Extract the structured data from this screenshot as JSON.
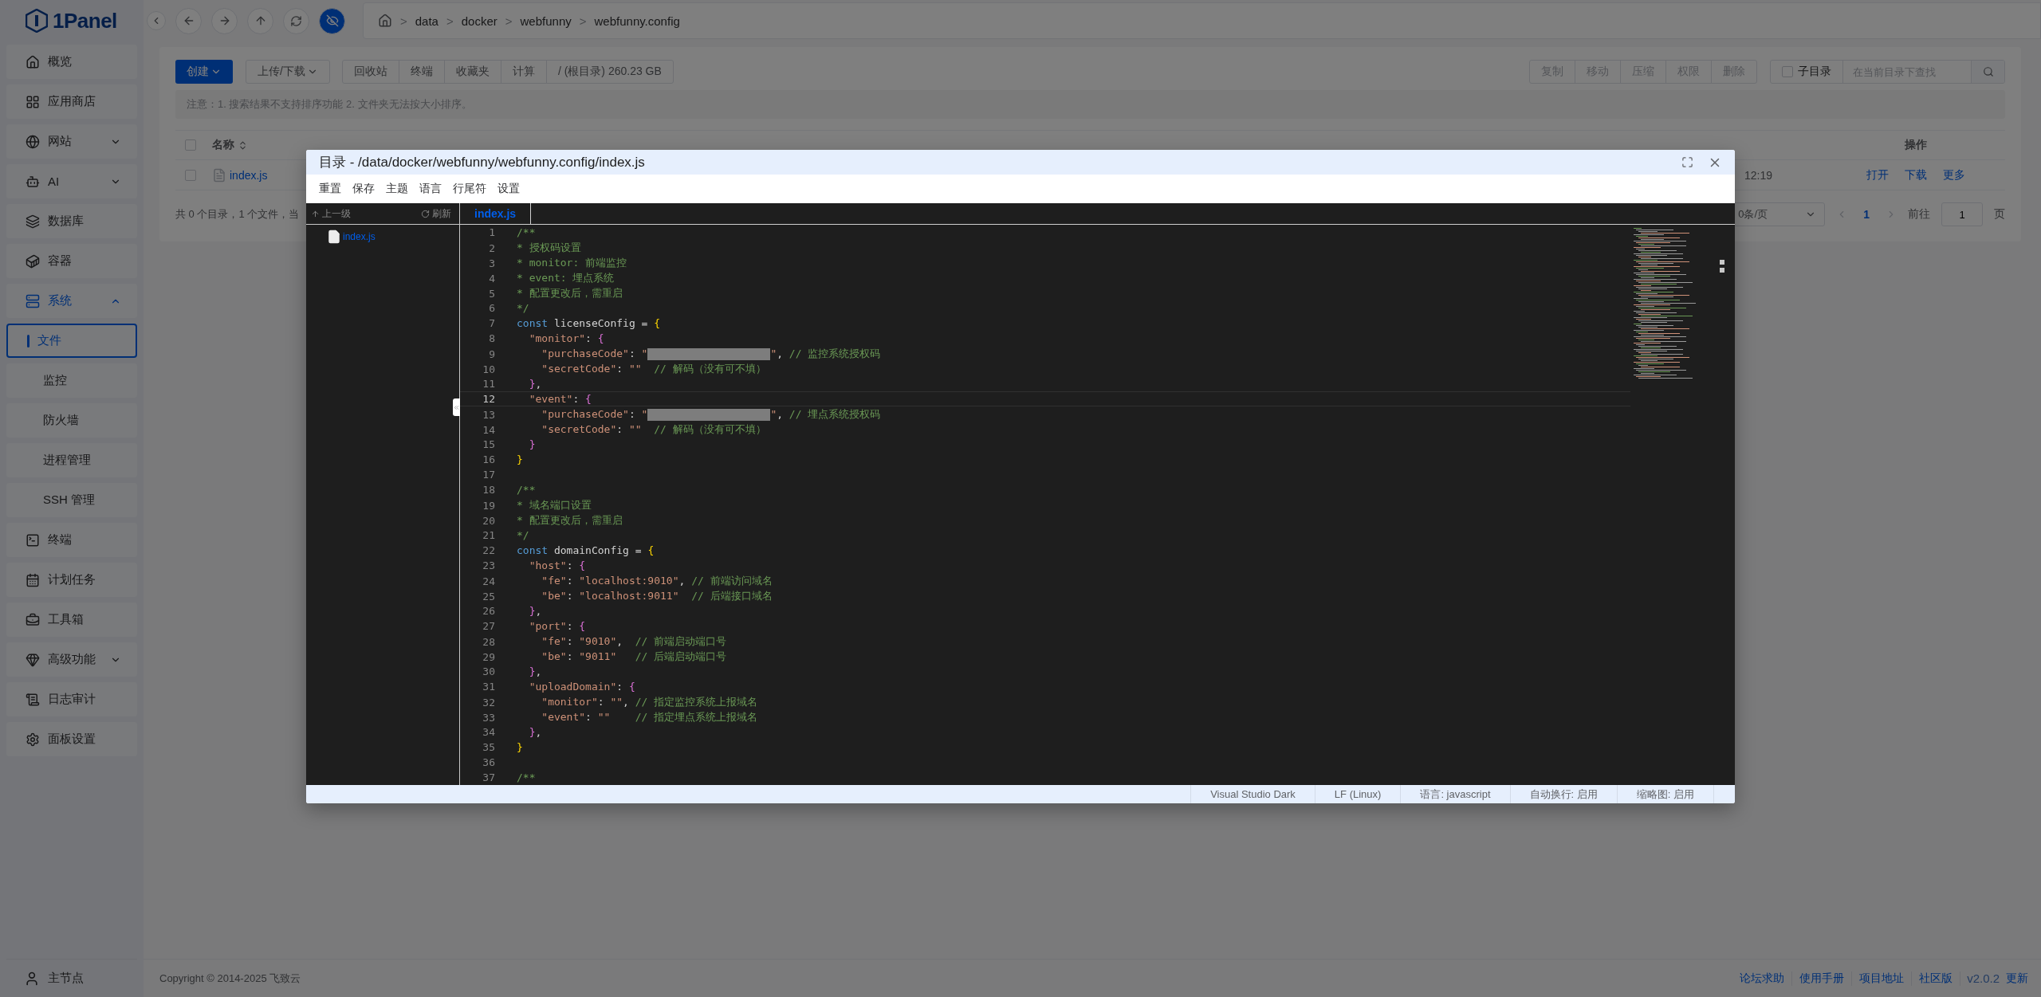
{
  "logo": {
    "text": "1Panel"
  },
  "breadcrumb": [
    {
      "separator": ">",
      "label": "data"
    },
    {
      "separator": ">",
      "label": "docker"
    },
    {
      "separator": ">",
      "label": "webfunny"
    },
    {
      "separator": ">",
      "label": "webfunny.config"
    }
  ],
  "sidebar": {
    "items": [
      {
        "label": "概览",
        "selected": false
      },
      {
        "label": "应用商店",
        "selected": false
      },
      {
        "label": "网站",
        "selected": false,
        "expanded": false
      },
      {
        "label": "AI",
        "selected": false,
        "expanded": false
      },
      {
        "label": "数据库",
        "selected": false
      },
      {
        "label": "容器",
        "selected": false
      },
      {
        "label": "系统",
        "selected": true,
        "expanded": true,
        "children": [
          {
            "label": "文件",
            "selected": true
          },
          {
            "label": "监控",
            "selected": false
          },
          {
            "label": "防火墙",
            "selected": false
          },
          {
            "label": "进程管理",
            "selected": false
          },
          {
            "label": "SSH 管理",
            "selected": false
          }
        ]
      },
      {
        "label": "终端",
        "selected": false
      },
      {
        "label": "计划任务",
        "selected": false
      },
      {
        "label": "工具箱",
        "selected": false
      },
      {
        "label": "高级功能",
        "selected": false,
        "expanded": false
      },
      {
        "label": "日志审计",
        "selected": false
      },
      {
        "label": "面板设置",
        "selected": false
      }
    ],
    "node": "主节点"
  },
  "toolbar": {
    "create": "创建",
    "upload": "上传/下载",
    "group": [
      "回收站",
      "终端",
      "收藏夹",
      "计算"
    ],
    "disk": "/ (根目录) 260.23 GB",
    "actions": [
      "复制",
      "移动",
      "压缩",
      "权限",
      "删除"
    ],
    "subdir": {
      "label": "子目录",
      "checked": false
    },
    "search": {
      "placeholder": "在当前目录下查找"
    }
  },
  "notice": "注意：1. 搜索结果不支持排序功能 2. 文件夹无法按大小排序。",
  "table": {
    "header_checked": false,
    "columns": [
      "名称",
      "操作"
    ],
    "rows": [
      {
        "checked": false,
        "name": "index.js",
        "time": "12:19",
        "actions": [
          "打开",
          "下载",
          "更多"
        ]
      }
    ]
  },
  "summary": "共 0 个目录，1 个文件，当",
  "pagination": {
    "page_size": "0条/页",
    "pages": [
      {
        "label": "1",
        "selected": true
      }
    ],
    "goto_label": "前往",
    "goto_value": "1",
    "unit": "页"
  },
  "footer": {
    "copyright": "Copyright © 2014-2025 飞致云",
    "links": [
      "论坛求助",
      "使用手册",
      "项目地址",
      "社区版"
    ],
    "version": "v2.0.2",
    "update": "更新"
  },
  "editor": {
    "title": "目录 - /data/docker/webfunny/webfunny.config/index.js",
    "menu": [
      "重置",
      "保存",
      "主题",
      "语言",
      "行尾符",
      "设置"
    ],
    "tree": {
      "up": "上一级",
      "refresh": "刷新",
      "files": [
        {
          "name": "index.js",
          "selected": true
        }
      ]
    },
    "tabs": [
      {
        "label": "index.js",
        "selected": true
      }
    ],
    "lines": [
      {
        "number": "1",
        "active": false,
        "tokens": [
          {
            "kind": "comment",
            "text": "/**"
          }
        ]
      },
      {
        "number": "2",
        "active": false,
        "tokens": [
          {
            "kind": "comment",
            "text": "* 授权码设置"
          }
        ]
      },
      {
        "number": "3",
        "active": false,
        "tokens": [
          {
            "kind": "comment",
            "text": "* monitor: 前端监控"
          }
        ]
      },
      {
        "number": "4",
        "active": false,
        "tokens": [
          {
            "kind": "comment",
            "text": "* event: 埋点系统"
          }
        ]
      },
      {
        "number": "5",
        "active": false,
        "tokens": [
          {
            "kind": "comment",
            "text": "* 配置更改后，需重启"
          }
        ]
      },
      {
        "number": "6",
        "active": false,
        "tokens": [
          {
            "kind": "comment",
            "text": "*/"
          }
        ]
      },
      {
        "number": "7",
        "active": false,
        "tokens": [
          {
            "kind": "keyword",
            "text": "const"
          },
          {
            "kind": "plain",
            "text": " licenseConfig = "
          },
          {
            "kind": "bracket1",
            "text": "{"
          }
        ]
      },
      {
        "number": "8",
        "active": false,
        "tokens": [
          {
            "kind": "string",
            "text": "  \"monitor\""
          },
          {
            "kind": "plain",
            "text": ": "
          },
          {
            "kind": "bracket2",
            "text": "{"
          }
        ]
      },
      {
        "number": "9",
        "active": false,
        "tokens": [
          {
            "kind": "string",
            "text": "    \"purchaseCode\""
          },
          {
            "kind": "plain",
            "text": ": "
          },
          {
            "kind": "string",
            "text": "\""
          },
          {
            "kind": "redacted"
          },
          {
            "kind": "string",
            "text": "\""
          },
          {
            "kind": "plain",
            "text": ", "
          },
          {
            "kind": "comment",
            "text": "// 监控系统授权码"
          }
        ]
      },
      {
        "number": "10",
        "active": false,
        "tokens": [
          {
            "kind": "string",
            "text": "    \"secretCode\""
          },
          {
            "kind": "plain",
            "text": ": "
          },
          {
            "kind": "string",
            "text": "\"\""
          },
          {
            "kind": "comment",
            "text": "  // 解码（没有可不填）"
          }
        ]
      },
      {
        "number": "11",
        "active": false,
        "tokens": [
          {
            "kind": "bracket2",
            "text": "  }"
          },
          {
            "kind": "plain",
            "text": ","
          }
        ]
      },
      {
        "number": "12",
        "active": true,
        "tokens": [
          {
            "kind": "string",
            "text": "  \"event\""
          },
          {
            "kind": "plain",
            "text": ": "
          },
          {
            "kind": "bracket2",
            "text": "{"
          }
        ]
      },
      {
        "number": "13",
        "active": false,
        "tokens": [
          {
            "kind": "string",
            "text": "    \"purchaseCode\""
          },
          {
            "kind": "plain",
            "text": ": "
          },
          {
            "kind": "string",
            "text": "\""
          },
          {
            "kind": "redacted"
          },
          {
            "kind": "string",
            "text": "\""
          },
          {
            "kind": "plain",
            "text": ", "
          },
          {
            "kind": "comment",
            "text": "// 埋点系统授权码"
          }
        ]
      },
      {
        "number": "14",
        "active": false,
        "tokens": [
          {
            "kind": "string",
            "text": "    \"secretCode\""
          },
          {
            "kind": "plain",
            "text": ": "
          },
          {
            "kind": "string",
            "text": "\"\""
          },
          {
            "kind": "comment",
            "text": "  // 解码（没有可不填）"
          }
        ]
      },
      {
        "number": "15",
        "active": false,
        "tokens": [
          {
            "kind": "bracket2",
            "text": "  }"
          }
        ]
      },
      {
        "number": "16",
        "active": false,
        "tokens": [
          {
            "kind": "bracket1",
            "text": "}"
          }
        ]
      },
      {
        "number": "17",
        "active": false
      },
      {
        "number": "18",
        "active": false,
        "tokens": [
          {
            "kind": "comment",
            "text": "/**"
          }
        ]
      },
      {
        "number": "19",
        "active": false,
        "tokens": [
          {
            "kind": "comment",
            "text": "* 域名端口设置"
          }
        ]
      },
      {
        "number": "20",
        "active": false,
        "tokens": [
          {
            "kind": "comment",
            "text": "* 配置更改后，需重启"
          }
        ]
      },
      {
        "number": "21",
        "active": false,
        "tokens": [
          {
            "kind": "comment",
            "text": "*/"
          }
        ]
      },
      {
        "number": "22",
        "active": false,
        "tokens": [
          {
            "kind": "keyword",
            "text": "const"
          },
          {
            "kind": "plain",
            "text": " domainConfig = "
          },
          {
            "kind": "bracket1",
            "text": "{"
          }
        ]
      },
      {
        "number": "23",
        "active": false,
        "tokens": [
          {
            "kind": "string",
            "text": "  \"host\""
          },
          {
            "kind": "plain",
            "text": ": "
          },
          {
            "kind": "bracket2",
            "text": "{"
          }
        ]
      },
      {
        "number": "24",
        "active": false,
        "tokens": [
          {
            "kind": "string",
            "text": "    \"fe\""
          },
          {
            "kind": "plain",
            "text": ": "
          },
          {
            "kind": "string",
            "text": "\"localhost:9010\""
          },
          {
            "kind": "plain",
            "text": ", "
          },
          {
            "kind": "comment",
            "text": "// 前端访问域名"
          }
        ]
      },
      {
        "number": "25",
        "active": false,
        "tokens": [
          {
            "kind": "string",
            "text": "    \"be\""
          },
          {
            "kind": "plain",
            "text": ": "
          },
          {
            "kind": "string",
            "text": "\"localhost:9011\""
          },
          {
            "kind": "comment",
            "text": "  // 后端接口域名"
          }
        ]
      },
      {
        "number": "26",
        "active": false,
        "tokens": [
          {
            "kind": "bracket2",
            "text": "  }"
          },
          {
            "kind": "plain",
            "text": ","
          }
        ]
      },
      {
        "number": "27",
        "active": false,
        "tokens": [
          {
            "kind": "string",
            "text": "  \"port\""
          },
          {
            "kind": "plain",
            "text": ": "
          },
          {
            "kind": "bracket2",
            "text": "{"
          }
        ]
      },
      {
        "number": "28",
        "active": false,
        "tokens": [
          {
            "kind": "string",
            "text": "    \"fe\""
          },
          {
            "kind": "plain",
            "text": ": "
          },
          {
            "kind": "string",
            "text": "\"9010\""
          },
          {
            "kind": "plain",
            "text": ",  "
          },
          {
            "kind": "comment",
            "text": "// 前端启动端口号"
          }
        ]
      },
      {
        "number": "29",
        "active": false,
        "tokens": [
          {
            "kind": "string",
            "text": "    \"be\""
          },
          {
            "kind": "plain",
            "text": ": "
          },
          {
            "kind": "string",
            "text": "\"9011\""
          },
          {
            "kind": "comment",
            "text": "   // 后端启动端口号"
          }
        ]
      },
      {
        "number": "30",
        "active": false,
        "tokens": [
          {
            "kind": "bracket2",
            "text": "  }"
          },
          {
            "kind": "plain",
            "text": ","
          }
        ]
      },
      {
        "number": "31",
        "active": false,
        "tokens": [
          {
            "kind": "string",
            "text": "  \"uploadDomain\""
          },
          {
            "kind": "plain",
            "text": ": "
          },
          {
            "kind": "bracket2",
            "text": "{"
          }
        ]
      },
      {
        "number": "32",
        "active": false,
        "tokens": [
          {
            "kind": "string",
            "text": "    \"monitor\""
          },
          {
            "kind": "plain",
            "text": ": "
          },
          {
            "kind": "string",
            "text": "\"\""
          },
          {
            "kind": "plain",
            "text": ", "
          },
          {
            "kind": "comment",
            "text": "// 指定监控系统上报域名"
          }
        ]
      },
      {
        "number": "33",
        "active": false,
        "tokens": [
          {
            "kind": "string",
            "text": "    \"event\""
          },
          {
            "kind": "plain",
            "text": ": "
          },
          {
            "kind": "string",
            "text": "\"\""
          },
          {
            "kind": "comment",
            "text": "    // 指定埋点系统上报域名"
          }
        ]
      },
      {
        "number": "34",
        "active": false,
        "tokens": [
          {
            "kind": "bracket2",
            "text": "  }"
          },
          {
            "kind": "plain",
            "text": ","
          }
        ]
      },
      {
        "number": "35",
        "active": false,
        "tokens": [
          {
            "kind": "bracket1",
            "text": "}"
          }
        ]
      },
      {
        "number": "36",
        "active": false
      },
      {
        "number": "37",
        "active": false,
        "tokens": [
          {
            "kind": "comment",
            "text": "/**"
          }
        ]
      }
    ],
    "status": [
      "Visual Studio Dark",
      "LF (Linux)",
      "语言: javascript",
      "自动换行: 启用",
      "缩略图: 启用"
    ]
  }
}
